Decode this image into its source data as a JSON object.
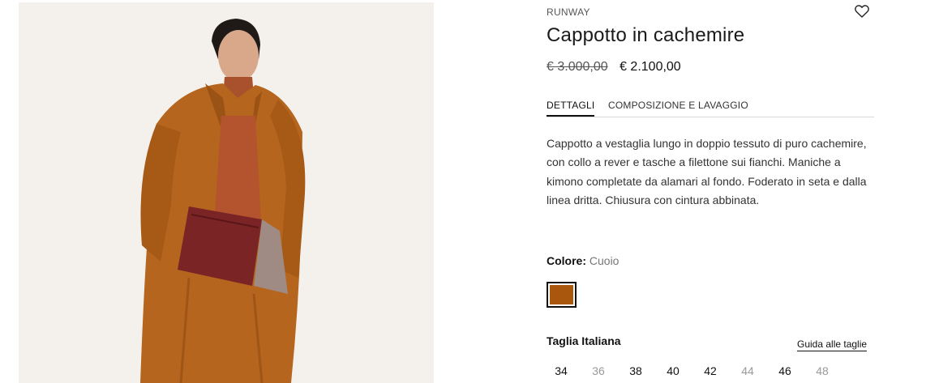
{
  "product": {
    "brand": "RUNWAY",
    "title": "Cappotto in cachemire",
    "price_old": "€ 3.000,00",
    "price_new": "€ 2.100,00"
  },
  "tabs": [
    {
      "label": "DETTAGLI",
      "active": true
    },
    {
      "label": "COMPOSIZIONE E LAVAGGIO",
      "active": false
    }
  ],
  "description": "Cappotto a vestaglia lungo in doppio tessuto di puro cachemire, con collo a rever e tasche a filettone sui fianchi. Maniche a kimono completate da alamari al fondo. Foderato in seta e dalla linea dritta. Chiusura con cintura abbinata.",
  "color": {
    "label": "Colore:",
    "value": "Cuoio",
    "swatch": "#a9570d"
  },
  "size": {
    "title": "Taglia Italiana",
    "guide_label": "Guida alle taglie",
    "options": [
      {
        "label": "34",
        "available": true
      },
      {
        "label": "36",
        "available": false
      },
      {
        "label": "38",
        "available": true
      },
      {
        "label": "40",
        "available": true
      },
      {
        "label": "42",
        "available": true
      },
      {
        "label": "44",
        "available": false
      },
      {
        "label": "46",
        "available": true
      },
      {
        "label": "48",
        "available": false
      }
    ]
  },
  "icons": {
    "wishlist": "heart-outline-icon"
  },
  "colors": {
    "text": "#1a1a1a",
    "muted": "#999999",
    "coat": "#b5651d",
    "background_photo": "#f4f1ed"
  }
}
